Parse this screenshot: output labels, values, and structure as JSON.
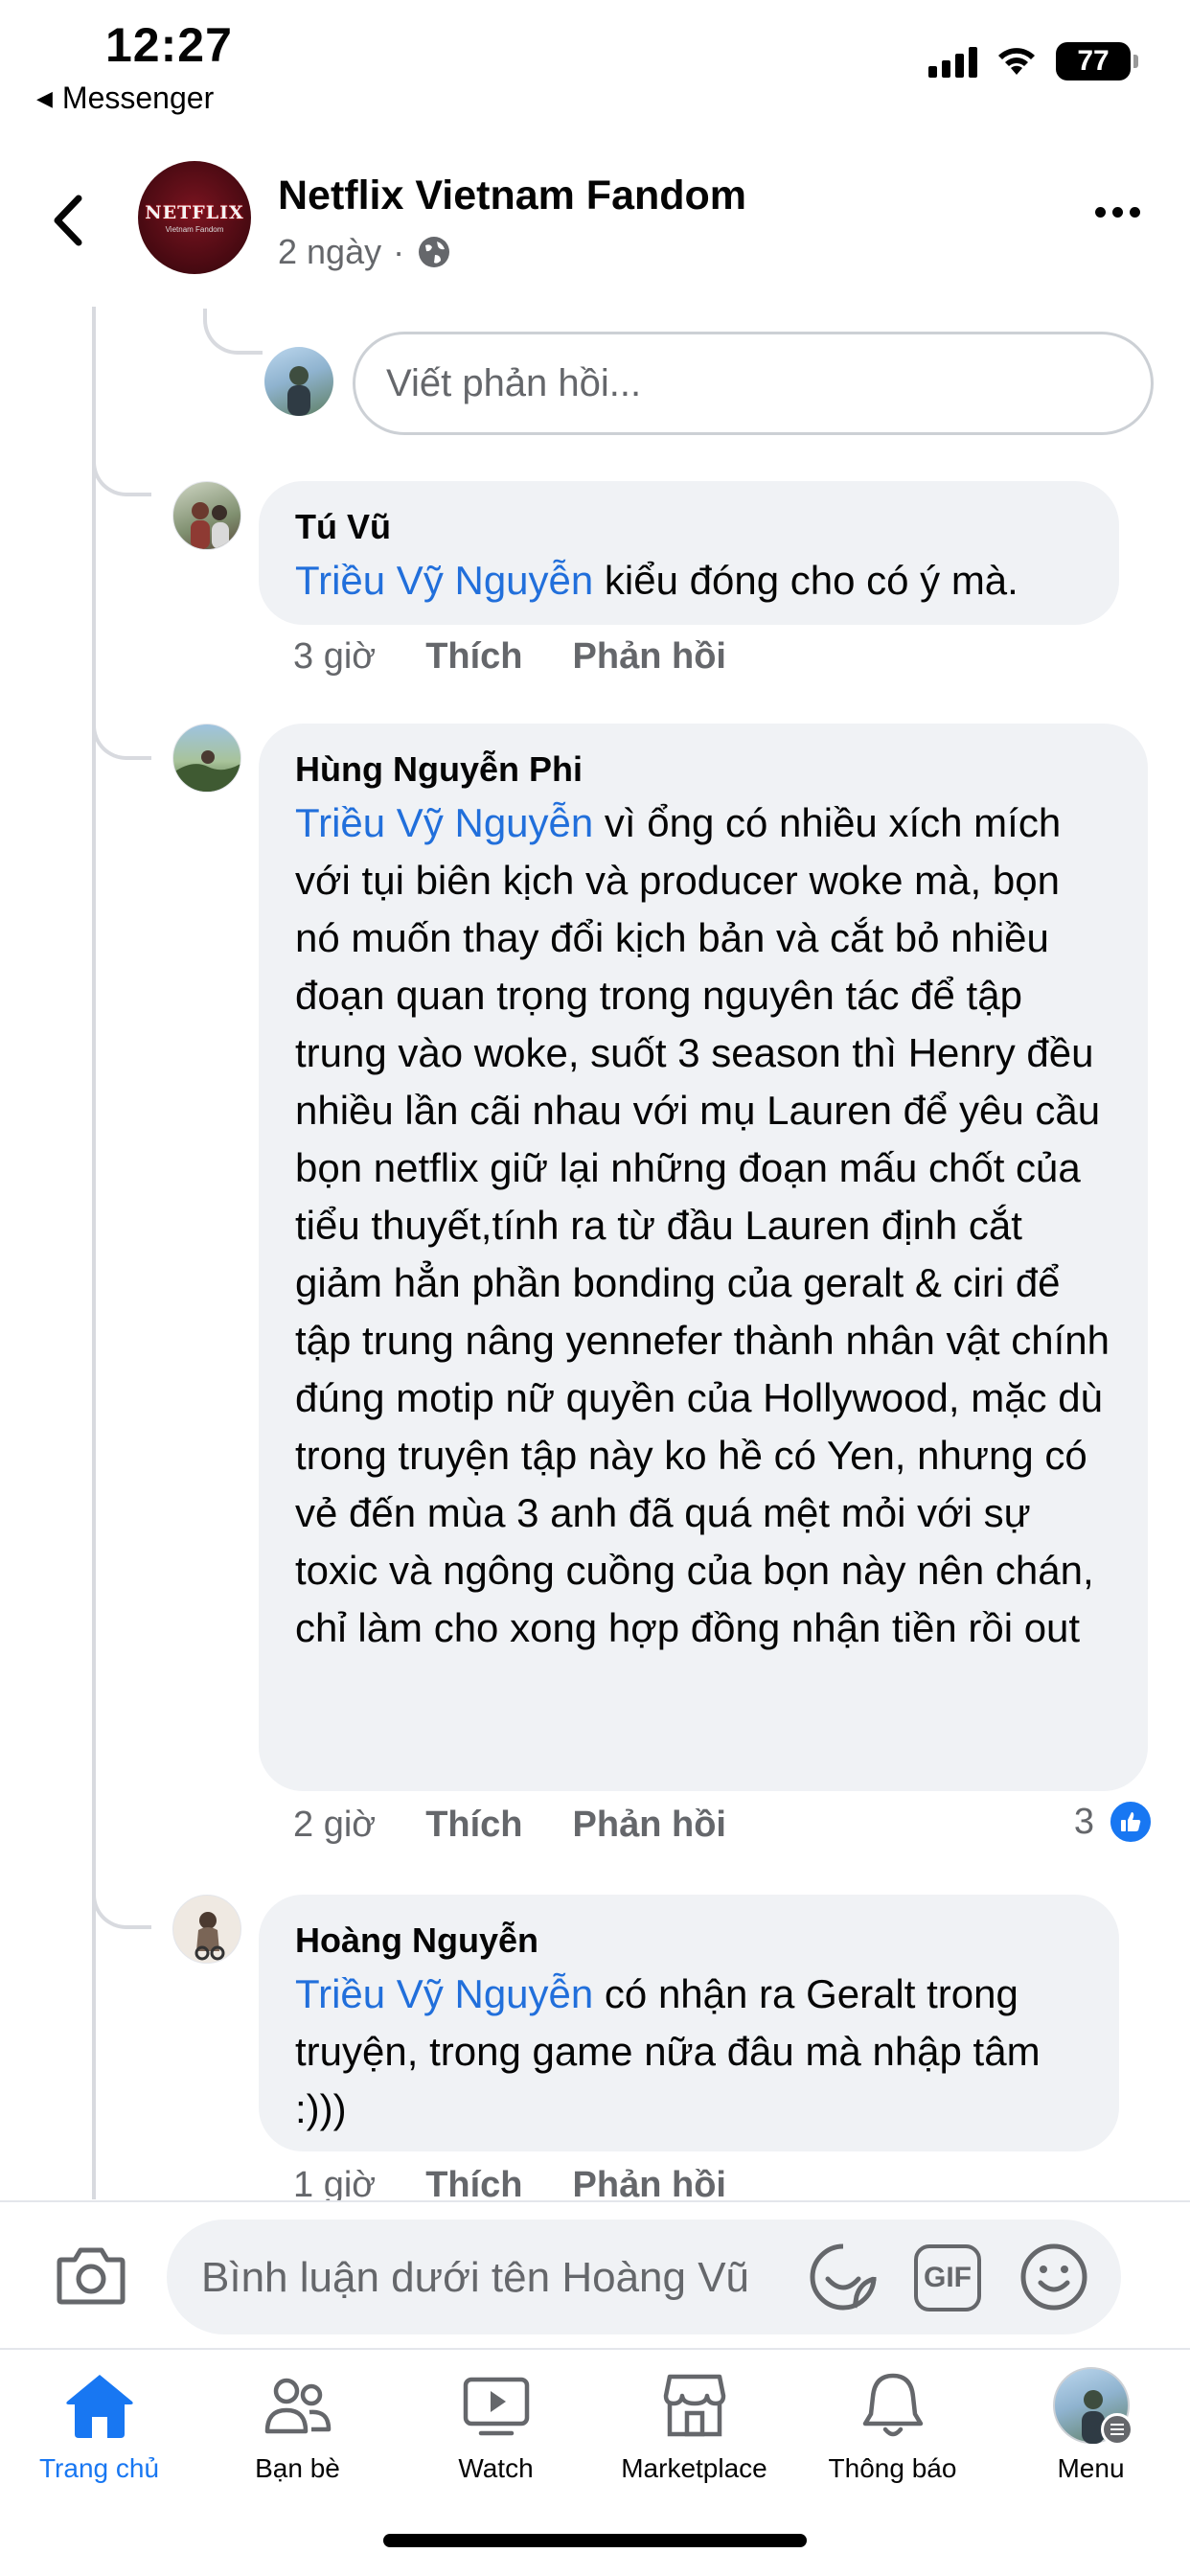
{
  "status_bar": {
    "time": "12:27",
    "back_app": "Messenger",
    "battery": "77",
    "icons": [
      "cellular-signal-icon",
      "wifi-icon",
      "battery-icon"
    ]
  },
  "header": {
    "page_name": "Netflix Vietnam Fandom",
    "avatar_text": "NETFLIX",
    "avatar_subtext": "Vietnam Fandom",
    "time_ago": "2 ngày",
    "separator": "·",
    "privacy_icon": "globe-icon"
  },
  "reply_box": {
    "placeholder": "Viết phản hồi..."
  },
  "comments": [
    {
      "author": "Tú Vũ",
      "mention": "Triều Vỹ Nguyễn",
      "text": " kiểu đóng cho có ý mà.",
      "time": "3 giờ",
      "like_label": "Thích",
      "reply_label": "Phản hồi"
    },
    {
      "author": "Hùng Nguyễn Phi",
      "mention": "Triều Vỹ Nguyễn",
      "text": " vì ổng có nhiều xích mích với tụi biên kịch và producer woke mà, bọn nó muốn thay đổi kịch bản và cắt bỏ nhiều đoạn quan trọng trong nguyên tác để tập trung vào woke, suốt 3 season thì Henry đều nhiều lần cãi nhau với mụ Lauren để yêu cầu bọn netflix giữ lại những đoạn mấu chốt của tiểu thuyết,tính ra từ đầu Lauren định cắt giảm hẳn phần bonding của geralt & ciri để tập trung nâng yennefer thành nhân vật chính đúng motip nữ quyền của Hollywood, mặc dù trong truyện tập này ko hề có Yen, nhưng có vẻ đến mùa 3 anh đã quá mệt mỏi với sự toxic và ngông cuồng của bọn này nên chán, chỉ làm cho xong hợp đồng nhận tiền rồi out",
      "time": "2 giờ",
      "like_label": "Thích",
      "reply_label": "Phản hồi",
      "reaction_count": "3"
    },
    {
      "author": "Hoàng Nguyễn",
      "mention": "Triều Vỹ Nguyễn",
      "text": " có nhận ra Geralt trong truyện, trong game nữa đâu mà nhập tâm :)))",
      "time": "1 giờ",
      "like_label": "Thích",
      "reply_label": "Phản hồi"
    }
  ],
  "composer": {
    "placeholder": "Bình luận dưới tên Hoàng Vũ",
    "gif_label": "GIF"
  },
  "tab_bar": [
    {
      "label": "Trang chủ",
      "icon": "home-icon",
      "active": true
    },
    {
      "label": "Bạn bè",
      "icon": "friends-icon",
      "active": false
    },
    {
      "label": "Watch",
      "icon": "watch-icon",
      "active": false
    },
    {
      "label": "Marketplace",
      "icon": "marketplace-icon",
      "active": false
    },
    {
      "label": "Thông báo",
      "icon": "bell-icon",
      "active": false
    },
    {
      "label": "Menu",
      "icon": "menu-avatar",
      "active": false
    }
  ],
  "colors": {
    "accent": "#1877f2",
    "mention": "#216fdb",
    "bubble": "#f0f2f5",
    "secondary_text": "#65676b"
  }
}
